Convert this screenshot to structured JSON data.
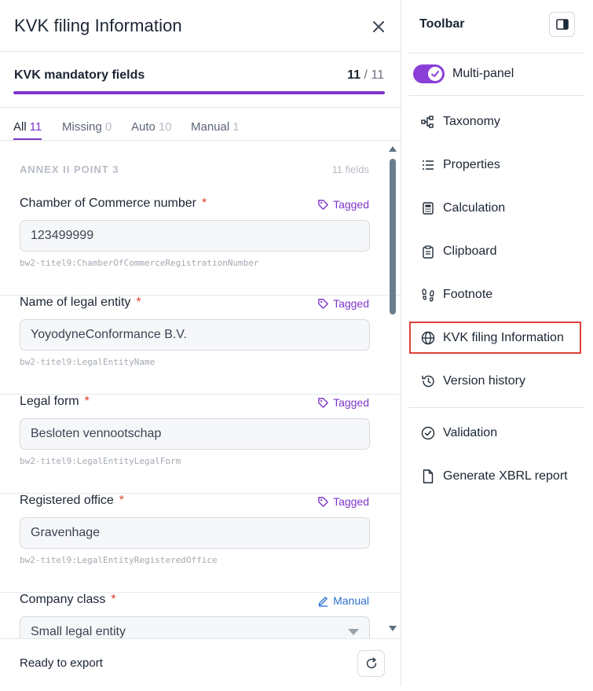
{
  "panel": {
    "title": "KVK filing Information",
    "mandatory": {
      "label": "KVK mandatory fields",
      "done": "11",
      "sep": "/",
      "total": "11",
      "progress": 1.0
    },
    "tabs": [
      {
        "label": "All",
        "count": "11",
        "active": true
      },
      {
        "label": "Missing",
        "count": "0",
        "active": false
      },
      {
        "label": "Auto",
        "count": "10",
        "active": false
      },
      {
        "label": "Manual",
        "count": "1",
        "active": false
      }
    ],
    "section": {
      "title": "ANNEX II POINT 3",
      "count": "11 fields"
    },
    "fields": [
      {
        "label": "Chamber of Commerce number",
        "required": "*",
        "tag": "Tagged",
        "value": "123499999",
        "code": "bw2-titel9:ChamberOfCommerceRegistrationNumber"
      },
      {
        "label": "Name of legal entity",
        "required": "*",
        "tag": "Tagged",
        "value": "YoyodyneConformance B.V.",
        "code": "bw2-titel9:LegalEntityName"
      },
      {
        "label": "Legal form",
        "required": "*",
        "tag": "Tagged",
        "value": "Besloten vennootschap",
        "code": "bw2-titel9:LegalEntityLegalForm"
      },
      {
        "label": "Registered office",
        "required": "*",
        "tag": "Tagged",
        "value": "Gravenhage",
        "code": "bw2-titel9:LegalEntityRegisteredOffice"
      },
      {
        "label": "Company class",
        "required": "*",
        "tag": "Manual",
        "value": "Small legal entity"
      }
    ],
    "footer": {
      "status": "Ready to export"
    }
  },
  "toolbar": {
    "title": "Toolbar",
    "multi_panel": {
      "label": "Multi-panel",
      "enabled": true
    },
    "items": [
      {
        "label": "Taxonomy",
        "icon": "taxonomy-icon"
      },
      {
        "label": "Properties",
        "icon": "list-icon"
      },
      {
        "label": "Calculation",
        "icon": "calculator-icon"
      },
      {
        "label": "Clipboard",
        "icon": "clipboard-icon"
      },
      {
        "label": "Footnote",
        "icon": "footprints-icon"
      },
      {
        "label": "KVK filing Information",
        "icon": "globe-icon",
        "highlighted": true
      },
      {
        "label": "Version history",
        "icon": "history-icon"
      }
    ],
    "items2": [
      {
        "label": "Validation",
        "icon": "check-circle-icon"
      },
      {
        "label": "Generate XBRL report",
        "icon": "file-icon"
      }
    ]
  },
  "colors": {
    "accent": "#7d35c9",
    "highlight_border": "#e0403a",
    "required": "#e0402e",
    "manual": "#2e6fd3"
  }
}
